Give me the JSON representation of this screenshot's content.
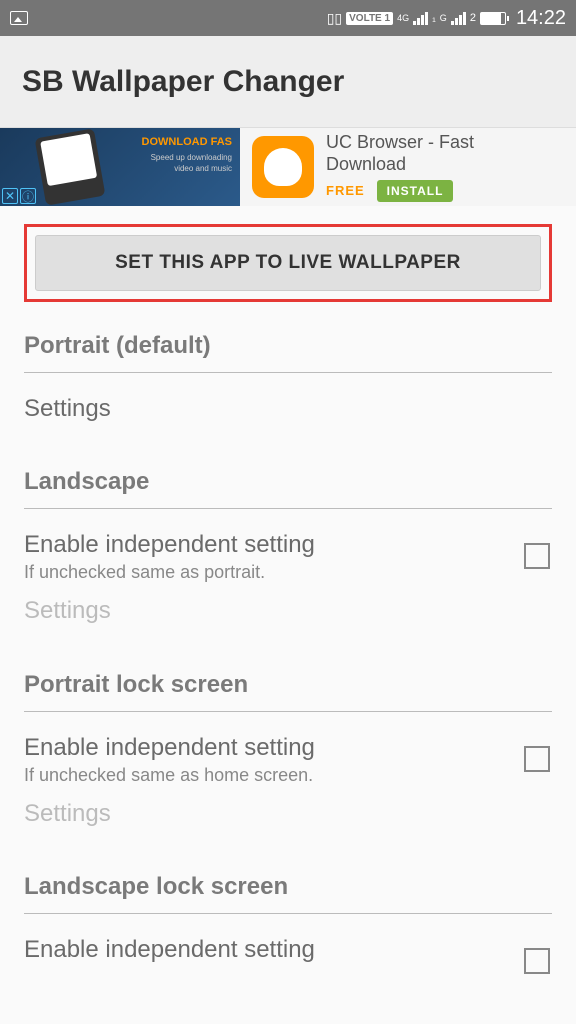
{
  "status_bar": {
    "volte": "VOLTE 1",
    "net1": "4G",
    "net2": "4G",
    "net3": "G",
    "sim": "2",
    "time": "14:22"
  },
  "header": {
    "title": "SB Wallpaper Changer"
  },
  "ad": {
    "left_title": "DOWNLOAD FAS",
    "left_sub1": "Speed up downloading",
    "left_sub2": "video and music",
    "app_name": "UC Browser - Fast Download",
    "price": "FREE",
    "cta": "INSTALL"
  },
  "main_button": "SET THIS APP TO LIVE WALLPAPER",
  "sections": [
    {
      "title": "Portrait (default)",
      "items": [
        {
          "label": "Settings",
          "sub": "",
          "checkbox": false,
          "disabled": false
        }
      ]
    },
    {
      "title": "Landscape",
      "items": [
        {
          "label": "Enable independent setting",
          "sub": "If unchecked same as portrait.",
          "checkbox": true,
          "disabled": false
        },
        {
          "label": "Settings",
          "sub": "",
          "checkbox": false,
          "disabled": true
        }
      ]
    },
    {
      "title": "Portrait lock screen",
      "items": [
        {
          "label": "Enable independent setting",
          "sub": "If unchecked same as home screen.",
          "checkbox": true,
          "disabled": false
        },
        {
          "label": "Settings",
          "sub": "",
          "checkbox": false,
          "disabled": true
        }
      ]
    },
    {
      "title": "Landscape lock screen",
      "items": [
        {
          "label": "Enable independent setting",
          "sub": "",
          "checkbox": true,
          "disabled": false
        }
      ]
    }
  ]
}
